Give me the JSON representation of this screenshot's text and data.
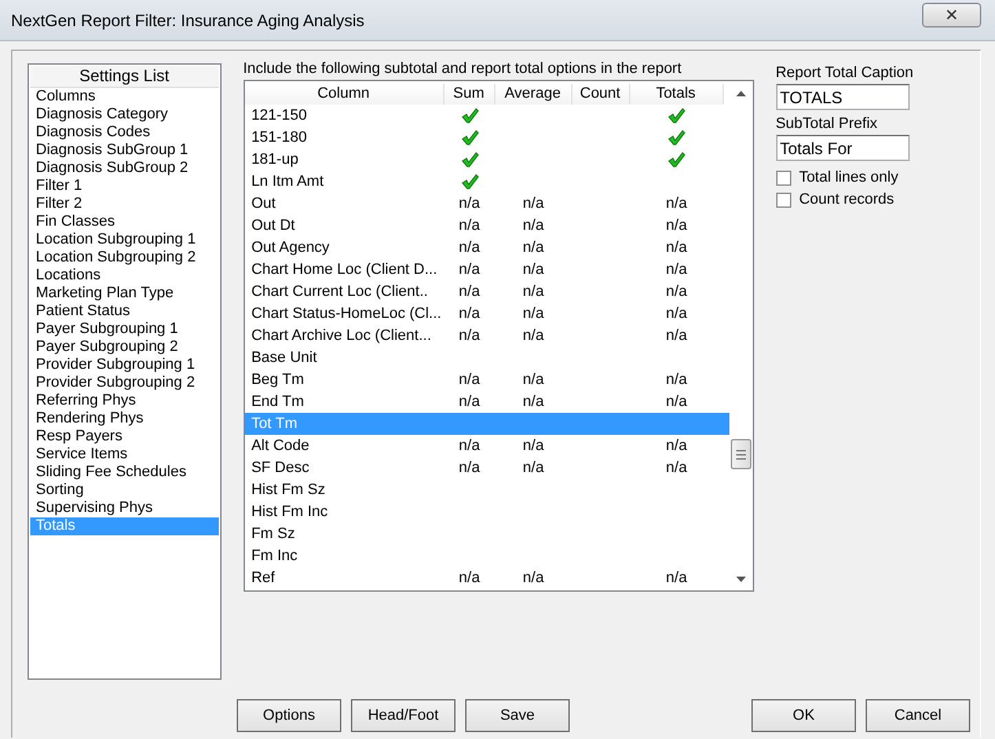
{
  "window": {
    "title": "NextGen Report Filter: Insurance Aging Analysis",
    "close": "✕"
  },
  "settings_list": {
    "title": "Settings List",
    "items": [
      {
        "label": "Columns",
        "selected": false
      },
      {
        "label": "Diagnosis Category",
        "selected": false
      },
      {
        "label": "Diagnosis Codes",
        "selected": false
      },
      {
        "label": "Diagnosis SubGroup 1",
        "selected": false
      },
      {
        "label": "Diagnosis SubGroup 2",
        "selected": false
      },
      {
        "label": "Filter 1",
        "selected": false
      },
      {
        "label": "Filter 2",
        "selected": false
      },
      {
        "label": "Fin Classes",
        "selected": false
      },
      {
        "label": "Location Subgrouping 1",
        "selected": false
      },
      {
        "label": "Location Subgrouping 2",
        "selected": false
      },
      {
        "label": "Locations",
        "selected": false
      },
      {
        "label": "Marketing Plan Type",
        "selected": false
      },
      {
        "label": "Patient Status",
        "selected": false
      },
      {
        "label": "Payer Subgrouping 1",
        "selected": false
      },
      {
        "label": "Payer Subgrouping 2",
        "selected": false
      },
      {
        "label": "Provider Subgrouping 1",
        "selected": false
      },
      {
        "label": "Provider Subgrouping 2",
        "selected": false
      },
      {
        "label": "Referring Phys",
        "selected": false
      },
      {
        "label": "Rendering Phys",
        "selected": false
      },
      {
        "label": "Resp Payers",
        "selected": false
      },
      {
        "label": "Service Items",
        "selected": false
      },
      {
        "label": "Sliding Fee Schedules",
        "selected": false
      },
      {
        "label": "Sorting",
        "selected": false
      },
      {
        "label": "Supervising Phys",
        "selected": false
      },
      {
        "label": "Totals",
        "selected": true
      }
    ]
  },
  "totals_table": {
    "instruction": "Include the following subtotal and report total options in the report",
    "columns": [
      "Column",
      "Sum",
      "Average",
      "Count",
      "Totals"
    ],
    "rows": [
      {
        "selected": false,
        "cells": [
          "121-150",
          {
            "kind": "check"
          },
          "",
          "",
          {
            "kind": "check"
          }
        ]
      },
      {
        "selected": false,
        "cells": [
          "151-180",
          {
            "kind": "check"
          },
          "",
          "",
          {
            "kind": "check"
          }
        ]
      },
      {
        "selected": false,
        "cells": [
          "181-up",
          {
            "kind": "check"
          },
          "",
          "",
          {
            "kind": "check"
          }
        ]
      },
      {
        "selected": false,
        "cells": [
          "Ln Itm Amt",
          {
            "kind": "check"
          },
          "",
          "",
          ""
        ]
      },
      {
        "selected": false,
        "cells": [
          "Out",
          "n/a",
          "n/a",
          "",
          "n/a"
        ]
      },
      {
        "selected": false,
        "cells": [
          "Out Dt",
          "n/a",
          "n/a",
          "",
          "n/a"
        ]
      },
      {
        "selected": false,
        "cells": [
          "Out Agency",
          "n/a",
          "n/a",
          "",
          "n/a"
        ]
      },
      {
        "selected": false,
        "cells": [
          "Chart Home Loc (Client D...",
          "n/a",
          "n/a",
          "",
          "n/a"
        ]
      },
      {
        "selected": false,
        "cells": [
          "Chart Current Loc (Client..",
          "n/a",
          "n/a",
          "",
          "n/a"
        ]
      },
      {
        "selected": false,
        "cells": [
          "Chart Status-HomeLoc (Cl...",
          "n/a",
          "n/a",
          "",
          "n/a"
        ]
      },
      {
        "selected": false,
        "cells": [
          "Chart Archive Loc (Client...",
          "n/a",
          "n/a",
          "",
          "n/a"
        ]
      },
      {
        "selected": false,
        "cells": [
          "Base Unit",
          "",
          "",
          "",
          ""
        ]
      },
      {
        "selected": false,
        "cells": [
          "Beg Tm",
          "n/a",
          "n/a",
          "",
          "n/a"
        ]
      },
      {
        "selected": false,
        "cells": [
          "End Tm",
          "n/a",
          "n/a",
          "",
          "n/a"
        ]
      },
      {
        "selected": true,
        "cells": [
          "Tot Tm",
          "",
          "",
          "",
          ""
        ]
      },
      {
        "selected": false,
        "cells": [
          "Alt Code",
          "n/a",
          "n/a",
          "",
          "n/a"
        ]
      },
      {
        "selected": false,
        "cells": [
          "SF Desc",
          "n/a",
          "n/a",
          "",
          "n/a"
        ]
      },
      {
        "selected": false,
        "cells": [
          "Hist Fm Sz",
          "",
          "",
          "",
          ""
        ]
      },
      {
        "selected": false,
        "cells": [
          "Hist Fm Inc",
          "",
          "",
          "",
          ""
        ]
      },
      {
        "selected": false,
        "cells": [
          "Fm Sz",
          "",
          "",
          "",
          ""
        ]
      },
      {
        "selected": false,
        "cells": [
          "Fm Inc",
          "",
          "",
          "",
          ""
        ]
      },
      {
        "selected": false,
        "cells": [
          "Ref",
          "n/a",
          "n/a",
          "",
          "n/a"
        ]
      }
    ]
  },
  "options": {
    "report_total_caption": {
      "label": "Report Total Caption",
      "value": "TOTALS"
    },
    "subtotal_prefix": {
      "label": "SubTotal Prefix",
      "value": "Totals For"
    },
    "checkboxes": [
      {
        "label": "Total lines only",
        "checked": false
      },
      {
        "label": "Count records",
        "checked": false
      }
    ]
  },
  "buttons_left": [
    "Options",
    "Head/Foot",
    "Save"
  ],
  "buttons_right": [
    "OK",
    "Cancel"
  ]
}
